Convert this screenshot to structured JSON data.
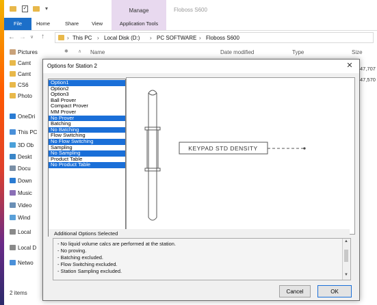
{
  "explorer": {
    "title": "Floboss S600",
    "ribbon_tabs": [
      "File",
      "Home",
      "Share",
      "View"
    ],
    "context_group": "Manage",
    "context_tab": "Application Tools",
    "breadcrumb": [
      "This PC",
      "Local Disk (D:)",
      "PC SOFTWARE",
      "Floboss S600"
    ],
    "columns": {
      "name": "Name",
      "date": "Date modified",
      "type": "Type",
      "size": "Size"
    },
    "sizes": [
      "47,707",
      "47,570"
    ],
    "nav_items": [
      {
        "label": "Pictures",
        "color": "#c9a27a"
      },
      {
        "label": "Camt",
        "color": "#e8b84a"
      },
      {
        "label": "Camt",
        "color": "#e8b84a"
      },
      {
        "label": "CS6",
        "color": "#e8b84a"
      },
      {
        "label": "Photo",
        "color": "#e8b84a"
      },
      {
        "label": "OneDri",
        "color": "#2b7cd3"
      },
      {
        "label": "This PC",
        "color": "#4a90d9"
      },
      {
        "label": "3D Ob",
        "color": "#4aa0d9"
      },
      {
        "label": "Deskt",
        "color": "#3a86c8"
      },
      {
        "label": "Docu",
        "color": "#7a8fa6"
      },
      {
        "label": "Down",
        "color": "#2b7cd3"
      },
      {
        "label": "Music",
        "color": "#8a6fb6"
      },
      {
        "label": "Video",
        "color": "#6a8fb6"
      },
      {
        "label": "Wind",
        "color": "#5aa0d9"
      },
      {
        "label": "Local",
        "color": "#8a8a8a"
      },
      {
        "label": "Local D",
        "color": "#8a8a8a"
      },
      {
        "label": "Netwo",
        "color": "#4a90d9"
      }
    ],
    "status": "2 items"
  },
  "dialog": {
    "title": "Options for Station 2",
    "options": [
      {
        "label": "Option1",
        "selected": true
      },
      {
        "label": "Option2",
        "selected": false
      },
      {
        "label": "Option3",
        "selected": false
      },
      {
        "label": "Ball Prover",
        "selected": false
      },
      {
        "label": "Compact Prover",
        "selected": false
      },
      {
        "label": "MM Prover",
        "selected": false
      },
      {
        "label": "No Prover",
        "selected": true
      },
      {
        "label": "Batching",
        "selected": false
      },
      {
        "label": "No Batching",
        "selected": true
      },
      {
        "label": "Flow Switching",
        "selected": false
      },
      {
        "label": "No Flow Switching",
        "selected": true
      },
      {
        "label": "Sampling",
        "selected": false
      },
      {
        "label": "No Sampling",
        "selected": true
      },
      {
        "label": "Product Table",
        "selected": false
      },
      {
        "label": "No Product Table",
        "selected": true
      }
    ],
    "diagram_label": "KEYPAD STD DENSITY",
    "additional_title": "Additional Options Selected",
    "additional_lines": [
      "- No liquid volume calcs are performed at the station.",
      "- No proving.",
      "- Batching excluded.",
      "- Flow Switching excluded.",
      "- Station Sampling excluded."
    ],
    "cancel_label": "Cancel",
    "ok_label": "OK"
  }
}
